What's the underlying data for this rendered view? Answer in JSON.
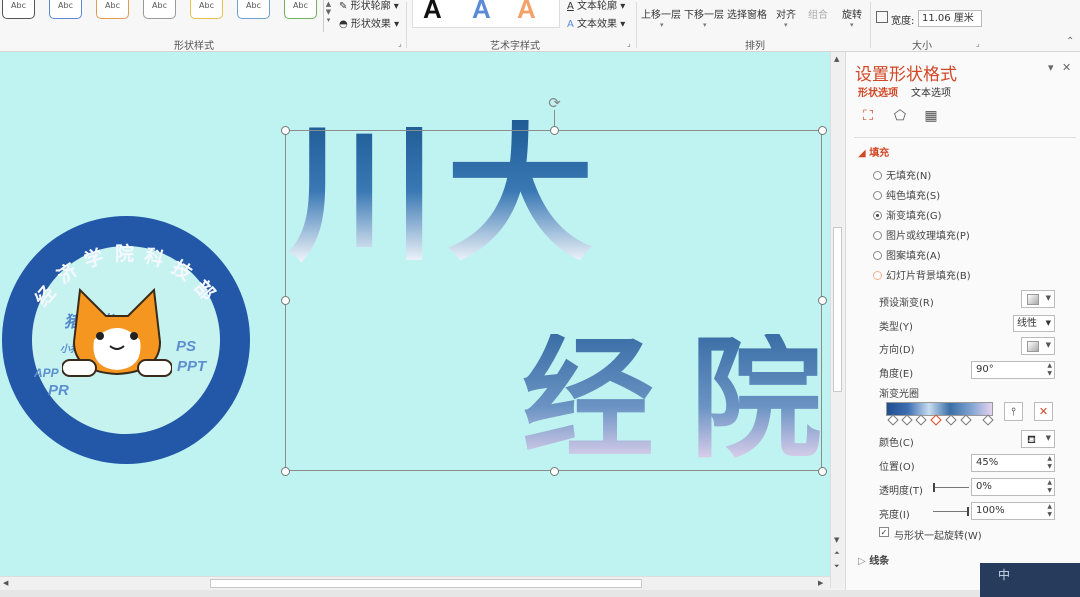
{
  "ribbon": {
    "shape_styles": {
      "label": "形状样式",
      "samples": [
        "Abc",
        "Abc",
        "Abc",
        "Abc",
        "Abc",
        "Abc",
        "Abc"
      ],
      "outline": "形状轮廓",
      "effects": "形状效果"
    },
    "wordart": {
      "label": "艺术字样式",
      "samples": [
        "A",
        "A",
        "A"
      ],
      "text_outline": "文本轮廓",
      "text_effects": "文本效果"
    },
    "arrange": {
      "label": "排列",
      "bring_forward": "上移一层",
      "send_backward": "下移一层",
      "selection_pane": "选择窗格",
      "align": "对齐",
      "group": "组合",
      "rotate": "旋转"
    },
    "size": {
      "label": "大小",
      "width_label": "宽度:",
      "width_value": "11.06 厘米"
    }
  },
  "canvas": {
    "chars": [
      "川",
      "大",
      "经",
      "院"
    ],
    "logo": {
      "ring_text": [
        "经",
        "济",
        "学",
        "院",
        "科",
        "技",
        "部"
      ],
      "subtitle": "猪猪猪~",
      "tagline": "小猪猪技能技术",
      "tags": [
        "PS",
        "PPT",
        "APP",
        "PR"
      ]
    }
  },
  "panel": {
    "title": "设置形状格式",
    "tabs": [
      "形状选项",
      "文本选项"
    ],
    "fill": {
      "header": "填充",
      "options": [
        "无填充(N)",
        "纯色填充(S)",
        "渐变填充(G)",
        "图片或纹理填充(P)",
        "图案填充(A)",
        "幻灯片背景填充(B)"
      ],
      "selected_index": 2,
      "preset_label": "预设渐变(R)",
      "type_label": "类型(Y)",
      "type_value": "线性",
      "direction_label": "方向(D)",
      "angle_label": "角度(E)",
      "angle_value": "90°",
      "stops_label": "渐变光圈",
      "color_label": "颜色(C)",
      "position_label": "位置(O)",
      "position_value": "45%",
      "transparency_label": "透明度(T)",
      "transparency_value": "0%",
      "brightness_label": "亮度(I)",
      "brightness_value": "100%",
      "rotate_with_shape": "与形状一起旋转(W)",
      "rotate_checked": true
    },
    "line_header": "线条"
  },
  "corner_text": "中",
  "colors": {
    "accent": "#d24726",
    "canvas_bg": "#bff3f2",
    "logo_blue": "#2357a8"
  }
}
